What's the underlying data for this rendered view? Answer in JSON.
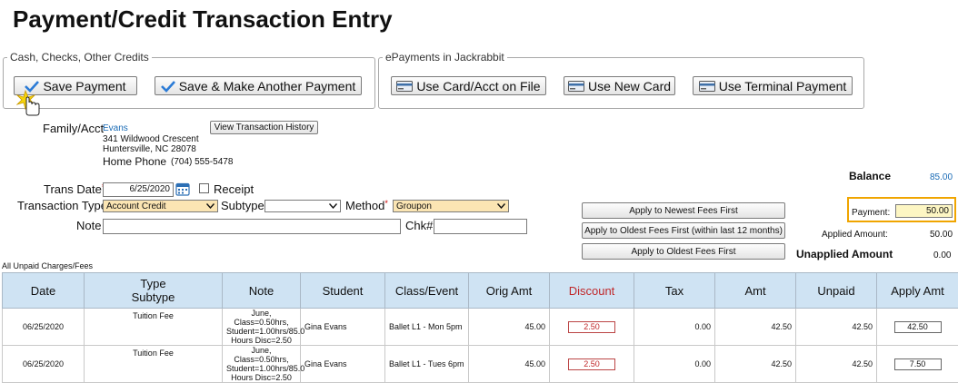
{
  "page": {
    "title": "Payment/Credit Transaction Entry"
  },
  "groups": {
    "cash_legend": "Cash, Checks, Other Credits",
    "epay_legend": "ePayments in Jackrabbit"
  },
  "buttons": {
    "save_payment": "Save Payment",
    "save_another": "Save & Make Another Payment",
    "use_card": "Use Card/Acct on File",
    "new_card": "Use New Card",
    "terminal": "Use Terminal Payment",
    "view_history": "View Transaction History",
    "apply_newest": "Apply to Newest Fees First",
    "apply_oldest_12": "Apply to Oldest Fees First (within last 12 months)",
    "apply_oldest": "Apply to Oldest Fees First"
  },
  "family": {
    "label": "Family/Acct",
    "name": "Evans",
    "address1": "341 Wildwood Crescent",
    "address2": "Huntersville, NC  28078",
    "home_phone_label": "Home Phone",
    "home_phone": "(704) 555-5478"
  },
  "form": {
    "trans_date_label": "Trans Date",
    "trans_date": "6/25/2020",
    "receipt_label": "Receipt",
    "trans_type_label": "Transaction Type",
    "trans_type": "Account Credit",
    "subtype_label": "Subtype",
    "subtype": "",
    "method_label": "Method",
    "method": "Groupon",
    "note_label": "Note",
    "note": "",
    "chk_label": "Chk#",
    "chk": ""
  },
  "summary": {
    "balance_label": "Balance",
    "balance": "85.00",
    "payment_label": "Payment:",
    "payment": "50.00",
    "applied_label": "Applied Amount:",
    "applied": "50.00",
    "unapplied_label": "Unapplied Amount",
    "unapplied": "0.00"
  },
  "table": {
    "caption": "All Unpaid Charges/Fees",
    "headers": {
      "date": "Date",
      "type": "Type",
      "subtype": "Subtype",
      "note": "Note",
      "student": "Student",
      "class": "Class/Event",
      "orig": "Orig Amt",
      "discount": "Discount",
      "tax": "Tax",
      "amt": "Amt",
      "unpaid": "Unpaid",
      "apply": "Apply Amt"
    },
    "rows": [
      {
        "date": "06/25/2020",
        "type": "Tuition Fee",
        "note1": "June, Class=0.50hrs,",
        "note2": "Student=1.00hrs/85.0",
        "note3": "Hours Disc=2.50",
        "student": "Gina Evans",
        "class": "Ballet L1 - Mon 5pm",
        "orig": "45.00",
        "discount": "2.50",
        "tax": "0.00",
        "amt": "42.50",
        "unpaid": "42.50",
        "apply": "42.50"
      },
      {
        "date": "06/25/2020",
        "type": "Tuition Fee",
        "note1": "June, Class=0.50hrs,",
        "note2": "Student=1.00hrs/85.0",
        "note3": "Hours Disc=2.50",
        "student": "Gina Evans",
        "class": "Ballet L1 - Tues 6pm",
        "orig": "45.00",
        "discount": "2.50",
        "tax": "0.00",
        "amt": "42.50",
        "unpaid": "42.50",
        "apply": "7.50"
      }
    ]
  },
  "colors": {
    "header_bg": "#cfe3f3",
    "highlight": "#f0a500",
    "link": "#1a6bb5",
    "discount": "#c0282a"
  }
}
